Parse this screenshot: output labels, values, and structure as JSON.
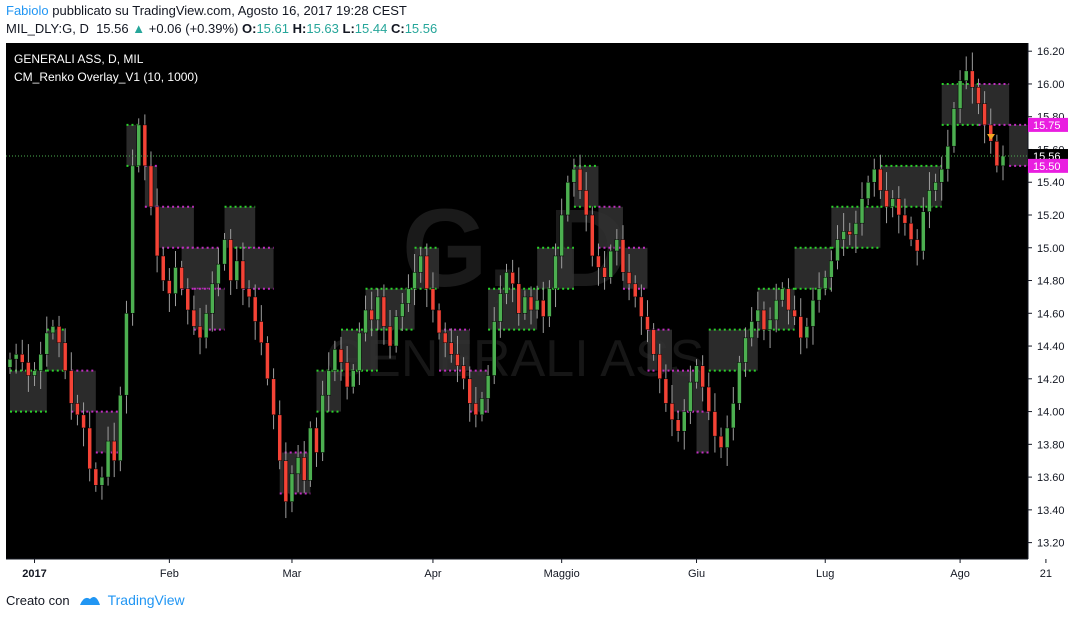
{
  "header": {
    "user": "Fabiolo",
    "published_text": "pubblicato su TradingView.com, Agosto 16, 2017 19:28 CEST",
    "symbol": "MIL_DLY:G, D",
    "last": "15.56",
    "change": "+0.06 (+0.39%)",
    "o_label": "O:",
    "o": "15.61",
    "h_label": "H:",
    "h": "15.63",
    "l_label": "L:",
    "l": "15.44",
    "c_label": "C:",
    "c": "15.56"
  },
  "legend": {
    "line1": "GENERALI ASS, D, MIL",
    "line2": "CM_Renko Overlay_V1 (10, 1000)"
  },
  "watermark": {
    "ticker": "G, D",
    "name": "GENERALI ASS"
  },
  "footer": {
    "created_with": "Creato con",
    "brand": "TradingView"
  },
  "colors": {
    "background": "#000000",
    "up_candle": "#4caf50",
    "down_candle": "#f44336",
    "renko_up": "#2bd12b",
    "renko_down": "#c02ec0",
    "axis_text": "#131722",
    "price_label": "#e91ee0"
  },
  "chart_data": {
    "type": "candlestick",
    "title": "",
    "xlabel": "",
    "ylabel": "",
    "ylim": [
      13.1,
      16.25
    ],
    "y_ticks": [
      13.2,
      13.4,
      13.6,
      13.8,
      14.0,
      14.2,
      14.4,
      14.6,
      14.8,
      15.0,
      15.2,
      15.4,
      15.6,
      15.8,
      16.0,
      16.2
    ],
    "x_labels": [
      {
        "label": "2017",
        "bar": 4
      },
      {
        "label": "Feb",
        "bar": 26
      },
      {
        "label": "Mar",
        "bar": 46
      },
      {
        "label": "Apr",
        "bar": 69
      },
      {
        "label": "Maggio",
        "bar": 90
      },
      {
        "label": "Giu",
        "bar": 112
      },
      {
        "label": "Lug",
        "bar": 133
      },
      {
        "label": "Ago",
        "bar": 155
      },
      {
        "label": "21",
        "bar": 169
      }
    ],
    "price_labels": [
      {
        "value": 15.75,
        "text": "15.75"
      },
      {
        "value": 15.56,
        "text": "15.56"
      },
      {
        "value": 15.5,
        "text": "15.50"
      }
    ],
    "last_price": 15.56,
    "closes": [
      14.32,
      14.35,
      14.3,
      14.22,
      14.25,
      14.35,
      14.48,
      14.52,
      14.42,
      14.25,
      14.05,
      13.98,
      13.9,
      13.65,
      13.55,
      13.6,
      13.82,
      13.7,
      14.1,
      14.6,
      15.5,
      15.75,
      15.5,
      15.25,
      14.95,
      14.8,
      14.72,
      14.88,
      14.75,
      14.62,
      14.52,
      14.45,
      14.6,
      14.78,
      14.9,
      15.05,
      14.8,
      14.92,
      14.75,
      14.7,
      14.55,
      14.42,
      14.2,
      13.98,
      13.7,
      13.45,
      13.62,
      13.72,
      13.58,
      13.9,
      13.75,
      14.1,
      14.25,
      14.38,
      14.3,
      14.15,
      14.25,
      14.48,
      14.62,
      14.56,
      14.7,
      14.52,
      14.4,
      14.58,
      14.66,
      14.75,
      14.85,
      14.95,
      14.75,
      14.62,
      14.48,
      14.42,
      14.35,
      14.28,
      14.2,
      14.05,
      13.98,
      14.08,
      14.22,
      14.55,
      14.72,
      14.85,
      14.78,
      14.6,
      14.7,
      14.62,
      14.68,
      14.58,
      14.75,
      14.95,
      15.2,
      15.4,
      15.48,
      15.35,
      15.2,
      14.95,
      14.88,
      14.82,
      14.98,
      15.05,
      14.85,
      14.78,
      14.7,
      14.58,
      14.5,
      14.35,
      14.2,
      14.05,
      13.95,
      13.88,
      14.0,
      14.18,
      14.28,
      14.15,
      14.0,
      13.85,
      13.78,
      13.9,
      14.05,
      14.3,
      14.45,
      14.55,
      14.62,
      14.5,
      14.56,
      14.68,
      14.75,
      14.62,
      14.58,
      14.45,
      14.52,
      14.68,
      14.75,
      14.82,
      14.92,
      15.05,
      15.1,
      15.08,
      15.15,
      15.3,
      15.4,
      15.48,
      15.35,
      15.25,
      15.3,
      15.2,
      15.15,
      15.05,
      14.98,
      15.22,
      15.35,
      15.4,
      15.48,
      15.62,
      15.85,
      16.02,
      16.08,
      15.98,
      15.88,
      15.75,
      15.65,
      15.5,
      15.56
    ],
    "renko_bricks_note": "bricks of 0.25",
    "renko_ranges": [
      [
        0,
        6,
        14.0,
        14.25,
        "up"
      ],
      [
        6,
        9,
        14.25,
        14.5,
        "up"
      ],
      [
        10,
        14,
        14.0,
        14.25,
        "down"
      ],
      [
        14,
        18,
        13.75,
        14.0,
        "down"
      ],
      [
        19,
        21,
        15.5,
        15.75,
        "up"
      ],
      [
        22,
        24,
        15.25,
        15.5,
        "down"
      ],
      [
        24,
        30,
        15.0,
        15.25,
        "down"
      ],
      [
        28,
        34,
        14.75,
        15.0,
        "down"
      ],
      [
        30,
        35,
        14.5,
        14.75,
        "down"
      ],
      [
        35,
        40,
        15.0,
        15.25,
        "up"
      ],
      [
        38,
        43,
        14.75,
        15.0,
        "down"
      ],
      [
        44,
        49,
        13.5,
        13.75,
        "down"
      ],
      [
        50,
        54,
        14.0,
        14.25,
        "up"
      ],
      [
        54,
        60,
        14.25,
        14.5,
        "up"
      ],
      [
        58,
        66,
        14.5,
        14.75,
        "up"
      ],
      [
        66,
        70,
        14.75,
        15.0,
        "up"
      ],
      [
        70,
        75,
        14.25,
        14.5,
        "down"
      ],
      [
        75,
        78,
        14.0,
        14.25,
        "down"
      ],
      [
        78,
        86,
        14.5,
        14.75,
        "up"
      ],
      [
        86,
        92,
        14.75,
        15.0,
        "up"
      ],
      [
        92,
        96,
        15.25,
        15.5,
        "up"
      ],
      [
        96,
        100,
        15.0,
        15.25,
        "down"
      ],
      [
        100,
        104,
        14.75,
        15.0,
        "down"
      ],
      [
        104,
        108,
        14.25,
        14.5,
        "down"
      ],
      [
        108,
        113,
        14.0,
        14.25,
        "down"
      ],
      [
        112,
        114,
        13.75,
        14.0,
        "down"
      ],
      [
        114,
        122,
        14.25,
        14.5,
        "up"
      ],
      [
        122,
        128,
        14.5,
        14.75,
        "up"
      ],
      [
        128,
        134,
        14.75,
        15.0,
        "up"
      ],
      [
        134,
        142,
        15.0,
        15.25,
        "up"
      ],
      [
        142,
        152,
        15.25,
        15.5,
        "up"
      ],
      [
        152,
        158,
        15.75,
        16.0,
        "up"
      ],
      [
        158,
        163,
        15.75,
        16.0,
        "down"
      ],
      [
        163,
        166,
        15.5,
        15.75,
        "down"
      ]
    ]
  }
}
